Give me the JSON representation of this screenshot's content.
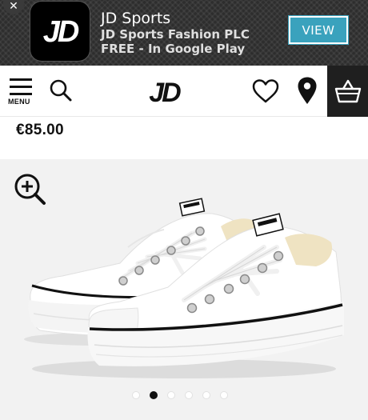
{
  "banner": {
    "close_symbol": "✕",
    "app_icon_text": "JD",
    "title": "JD Sports",
    "publisher": "JD Sports Fashion PLC",
    "offer": "FREE - In Google Play",
    "view_label": "VIEW",
    "view_color": "#3aa2bd"
  },
  "header": {
    "menu_label": "MENU",
    "logo_text": "JD",
    "icons": [
      "menu-icon",
      "search-icon",
      "jd-logo",
      "heart-icon",
      "location-pin-icon",
      "basket-icon"
    ],
    "basket_bg": "#1f1f1f"
  },
  "product": {
    "price": "€85.00",
    "image_alt": "white low-top platform canvas sneakers",
    "gallery": {
      "count": 6,
      "active_index": 1
    }
  }
}
